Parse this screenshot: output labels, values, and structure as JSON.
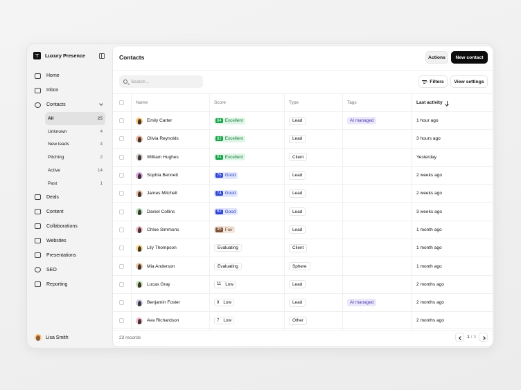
{
  "app": {
    "name": "Luxury Presence"
  },
  "sidebar": {
    "items": [
      {
        "label": "Home",
        "icon": "home-icon"
      },
      {
        "label": "Inbox",
        "icon": "inbox-icon"
      },
      {
        "label": "Contacts",
        "icon": "user-icon",
        "expanded": true
      }
    ],
    "contacts_sub": [
      {
        "label": "All",
        "count": "25",
        "active": true
      },
      {
        "label": "Unknown",
        "count": "4"
      },
      {
        "label": "New leads",
        "count": "4"
      },
      {
        "label": "Pitching",
        "count": "2"
      },
      {
        "label": "Active",
        "count": "14"
      },
      {
        "label": "Past",
        "count": "1"
      }
    ],
    "items_after": [
      {
        "label": "Deals",
        "icon": "deals-icon"
      },
      {
        "label": "Content",
        "icon": "content-icon"
      },
      {
        "label": "Collaborations",
        "icon": "collaborations-icon"
      },
      {
        "label": "Websites",
        "icon": "websites-icon"
      },
      {
        "label": "Presentations",
        "icon": "presentations-icon"
      },
      {
        "label": "SEO",
        "icon": "seo-icon"
      },
      {
        "label": "Reporting",
        "icon": "reporting-icon"
      }
    ],
    "user": {
      "name": "Lisa Smith"
    }
  },
  "header": {
    "title": "Contacts",
    "actions_label": "Actions",
    "new_contact_label": "New contact"
  },
  "toolbar": {
    "search_placeholder": "Search...",
    "filters_label": "Filters",
    "view_settings_label": "View settings"
  },
  "table": {
    "columns": [
      "Name",
      "Score",
      "Type",
      "Tags",
      "Last activity"
    ],
    "rows": [
      {
        "name": "Emily Carter",
        "score": "84",
        "score_label": "Excellent",
        "level": "green",
        "type": "Lead",
        "tag": "AI managed",
        "last": "1 hour ago",
        "avatar": "#f3c77a"
      },
      {
        "name": "Olivia Reynolds",
        "score": "82",
        "score_label": "Excellent",
        "level": "green",
        "type": "Lead",
        "tag": "",
        "last": "3 hours ago",
        "avatar": "#e7b59b"
      },
      {
        "name": "William Hughes",
        "score": "81",
        "score_label": "Excellent",
        "level": "green",
        "type": "Client",
        "tag": "",
        "last": "Yesterday",
        "avatar": "#cfcfcf"
      },
      {
        "name": "Sophia Bennett",
        "score": "75",
        "score_label": "Good",
        "level": "blue",
        "type": "Lead",
        "tag": "",
        "last": "2 weeks ago",
        "avatar": "#d9a6e0"
      },
      {
        "name": "James Mitchell",
        "score": "74",
        "score_label": "Good",
        "level": "blue",
        "type": "Lead",
        "tag": "",
        "last": "2 weeks ago",
        "avatar": "#e9c8b0"
      },
      {
        "name": "Daniel Collins",
        "score": "62",
        "score_label": "Good",
        "level": "blue",
        "type": "Lead",
        "tag": "",
        "last": "3 weeks ago",
        "avatar": "#b8e0c2"
      },
      {
        "name": "Chloe Simmons",
        "score": "45",
        "score_label": "Fair",
        "level": "brown",
        "type": "Lead",
        "tag": "",
        "last": "1 month ago",
        "avatar": "#f2b9c6"
      },
      {
        "name": "Lily Thompson",
        "score": "",
        "score_label": "Evaluating",
        "level": "plain",
        "type": "Client",
        "tag": "",
        "last": "1 month ago",
        "avatar": "#f4dc98"
      },
      {
        "name": "Mia Anderson",
        "score": "",
        "score_label": "Evaluating",
        "level": "plain",
        "type": "Sphere",
        "tag": "",
        "last": "1 month ago",
        "avatar": "#e8c5a8"
      },
      {
        "name": "Lucas Gray",
        "score": "11",
        "score_label": "Low",
        "level": "low",
        "type": "Lead",
        "tag": "",
        "last": "2 months ago",
        "avatar": "#c5e3b5"
      },
      {
        "name": "Benjamin Foster",
        "score": "9",
        "score_label": "Low",
        "level": "low",
        "type": "Lead",
        "tag": "AI managed",
        "last": "2 months ago",
        "avatar": "#c9c9e8"
      },
      {
        "name": "Ava Richardson",
        "score": "7",
        "score_label": "Low",
        "level": "low",
        "type": "Other",
        "tag": "",
        "last": "2 months ago",
        "avatar": "#f0c3d0"
      }
    ]
  },
  "footer": {
    "records": "23 records",
    "page_current": "1",
    "page_total": "/ 3"
  }
}
